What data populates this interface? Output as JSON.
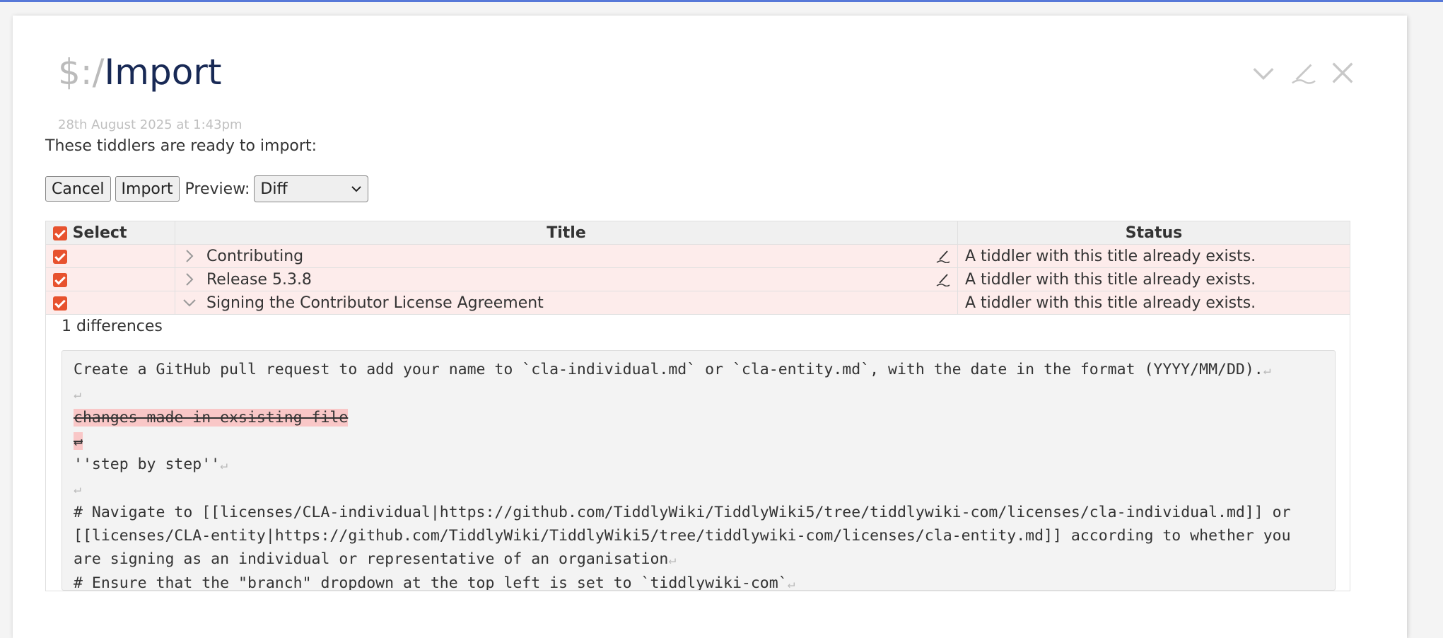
{
  "header": {
    "title_prefix": "$:/",
    "title_main": "Import",
    "subtitle": "28th August 2025 at 1:43pm"
  },
  "controls": {
    "fold_icon": "chevron-down-icon",
    "edit_icon": "pencil-icon",
    "close_icon": "close-icon"
  },
  "intro_text": "These tiddlers are ready to import:",
  "buttons": {
    "cancel": "Cancel",
    "import": "Import",
    "preview_label": "Preview:",
    "preview_value": "Diff"
  },
  "table": {
    "headers": [
      "Select",
      "Title",
      "Status"
    ],
    "rows": [
      {
        "title": "Contributing",
        "status": "A tiddler with this title already exists.",
        "checked": true,
        "expanded": false
      },
      {
        "title": "Release 5.3.8",
        "status": "A tiddler with this title already exists.",
        "checked": true,
        "expanded": false
      },
      {
        "title": "Signing the Contributor License Agreement",
        "status": "A tiddler with this title already exists.",
        "checked": true,
        "expanded": true
      }
    ],
    "diff_count": "1 differences"
  },
  "diff": {
    "line1": "Create a GitHub pull request to add your name to `cla-individual.md` or `cla-entity.md`, with the date in the format (YYYY/MM/DD).",
    "deleted1": "changes made in exsisting file ",
    "deleted2": "↵",
    "line3": "''step by step''",
    "line4": "# Navigate to [[licenses/CLA-individual|https://github.com/TiddlyWiki/TiddlyWiki5/tree/tiddlywiki-com/licenses/cla-individual.md]] or [[licenses/CLA-entity|https://github.com/TiddlyWiki/TiddlyWiki5/tree/tiddlywiki-com/licenses/cla-entity.md]] according to whether you are signing as an individual or representative of an organisation",
    "line5": "# Ensure that the \"branch\" dropdown at the top left is set to `tiddlywiki-com`",
    "return_symbol": "↵"
  },
  "colors": {
    "accent": "#e7522e",
    "title": "#182955",
    "row_highlight": "#fdeceb",
    "deleted": "#f9c7c7"
  }
}
